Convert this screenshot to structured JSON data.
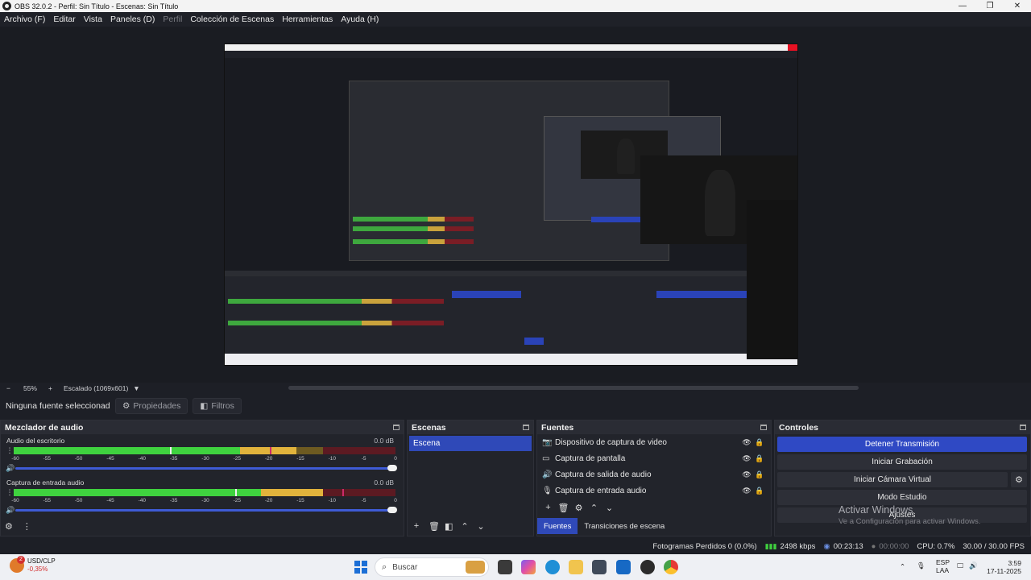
{
  "window": {
    "title": "OBS 32.0.2 - Perfil: Sin Título - Escenas: Sin Título",
    "minimize": "—",
    "maximize": "❐",
    "close": "✕"
  },
  "menu": [
    {
      "label": "Archivo (F)",
      "enabled": true
    },
    {
      "label": "Editar",
      "enabled": true
    },
    {
      "label": "Vista",
      "enabled": true
    },
    {
      "label": "Paneles (D)",
      "enabled": true
    },
    {
      "label": "Perfil",
      "enabled": false
    },
    {
      "label": "Colección de Escenas",
      "enabled": true
    },
    {
      "label": "Herramientas",
      "enabled": true
    },
    {
      "label": "Ayuda (H)",
      "enabled": true
    }
  ],
  "zoom": {
    "minus": "−",
    "value": "55%",
    "plus": "+",
    "scaling": "Escalado (1069x601)"
  },
  "source_toolbar": {
    "no_source": "Ninguna fuente seleccionada",
    "properties": "Propiedades",
    "filters": "Filtros"
  },
  "mixer": {
    "title": "Mezclador de audio",
    "tracks": [
      {
        "name": "Audio del escritorio",
        "db": "0.0 dB",
        "level": 0.74,
        "peak": 0.41
      },
      {
        "name": "Captura de entrada audio",
        "db": "0.0 dB",
        "level": 0.81,
        "peak": 0.58
      }
    ],
    "tick_labels": [
      "-60",
      "-55",
      "-50",
      "-45",
      "-40",
      "-35",
      "-30",
      "-25",
      "-20",
      "-15",
      "-10",
      "-5",
      "0"
    ]
  },
  "scenes": {
    "title": "Escenas",
    "items": [
      "Escena"
    ],
    "selected": 0
  },
  "sources": {
    "title": "Fuentes",
    "items": [
      {
        "name": "Dispositivo de captura de video",
        "icon": "camera-icon"
      },
      {
        "name": "Captura de pantalla",
        "icon": "monitor-icon"
      },
      {
        "name": "Captura de salida de audio",
        "icon": "speaker-icon"
      },
      {
        "name": "Captura de entrada audio",
        "icon": "microphone-icon"
      }
    ],
    "tabs": [
      "Fuentes",
      "Transiciones de escena"
    ]
  },
  "controls": {
    "title": "Controles",
    "stop_stream": "Detener Transmisión",
    "start_recording": "Iniciar Grabación",
    "start_virtual_camera": "Iniciar Cámara Virtual",
    "studio_mode": "Modo Estudio",
    "settings": "Ajustes"
  },
  "activation": {
    "line1": "Activar Windows",
    "line2": "Ve a Configuración para activar Windows."
  },
  "status": {
    "dropped_frames": "Fotogramas Perdidos 0 (0.0%)",
    "bitrate": "2498 kbps",
    "stream_time": "00:23:13",
    "record_time": "00:00:00",
    "cpu": "CPU: 0.7%",
    "fps": "30.00 / 30.00 FPS"
  },
  "taskbar": {
    "weather_badge": "2",
    "ticker": "USD/CLP",
    "change": "-0,35%",
    "search": "Buscar",
    "lang1": "ESP",
    "lang2": "LAA",
    "time": "3:59",
    "date": "17-11-2025"
  }
}
